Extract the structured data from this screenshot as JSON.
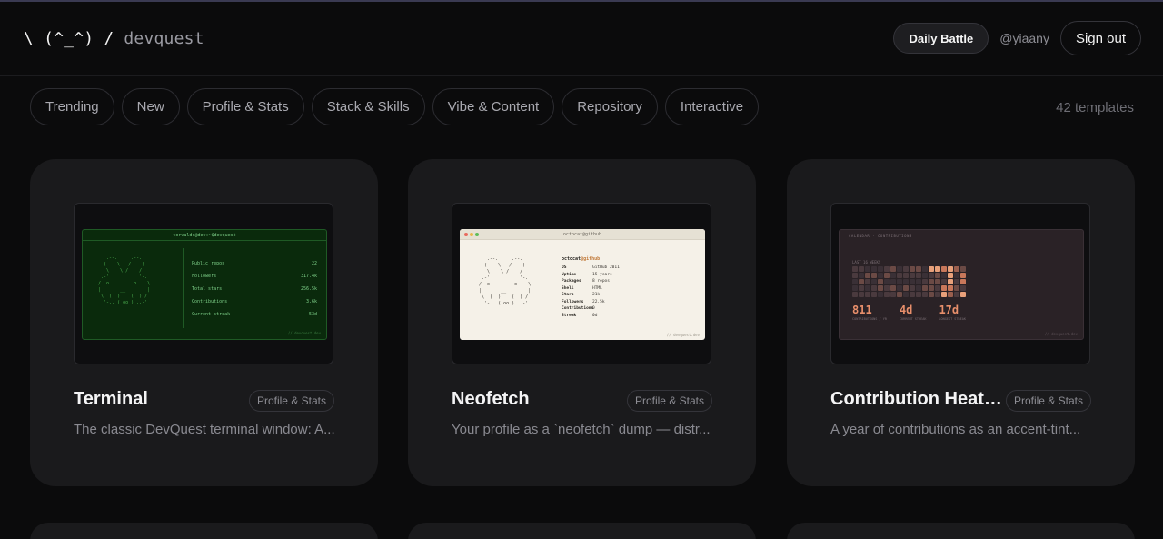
{
  "header": {
    "logo_face": "\\ (^_^) /",
    "logo_brand": "devquest",
    "daily_battle": "Daily Battle",
    "username": "@yiaany",
    "sign_out": "Sign out"
  },
  "filters": [
    "Trending",
    "New",
    "Profile & Stats",
    "Stack & Skills",
    "Vibe & Content",
    "Repository",
    "Interactive"
  ],
  "template_count": "42 templates",
  "cards": [
    {
      "title": "Terminal",
      "tag": "Profile & Stats",
      "description": "The classic DevQuest terminal window: A...",
      "preview": {
        "bar_title": "torvalds@dev:~$devquest",
        "rows": [
          {
            "label": "Public repos",
            "value": "22"
          },
          {
            "label": "Followers",
            "value": "317.4k"
          },
          {
            "label": "Total stars",
            "value": "256.5k"
          },
          {
            "label": "Contributions",
            "value": "3.6k"
          },
          {
            "label": "Current streak",
            "value": "53d"
          }
        ],
        "footer": "// devquest.dev"
      }
    },
    {
      "title": "Neofetch",
      "tag": "Profile & Stats",
      "description": "Your profile as a `neofetch` dump — distr...",
      "preview": {
        "bar_title": "octocat@github",
        "user": "octocat",
        "host": "@github",
        "rows": [
          {
            "k": "OS",
            "v": "GitHub 2011"
          },
          {
            "k": "Uptime",
            "v": "15 years"
          },
          {
            "k": "Packages",
            "v": "8 repos"
          },
          {
            "k": "Shell",
            "v": "HTML"
          },
          {
            "k": "Stars",
            "v": "21k"
          },
          {
            "k": "Followers",
            "v": "22.5k"
          },
          {
            "k": "Contributions",
            "v": "0"
          },
          {
            "k": "Streak",
            "v": "0d"
          }
        ],
        "footer": "// devquest.dev"
      }
    },
    {
      "title": "Contribution Heatmap",
      "tag": "Profile & Stats",
      "description": "A year of contributions as an accent-tint...",
      "preview": {
        "header": "CALENDAR · CONTRIBUTIONS",
        "range_label": "LAST 16 WEEKS",
        "stats": [
          {
            "value": "811",
            "label": "CONTRIBUTIONS / YR"
          },
          {
            "value": "4d",
            "label": "CURRENT STREAK"
          },
          {
            "value": "17d",
            "label": "LONGEST STREAK"
          }
        ],
        "footer": "// devquest.dev",
        "accent": "#e88f6b"
      }
    }
  ]
}
